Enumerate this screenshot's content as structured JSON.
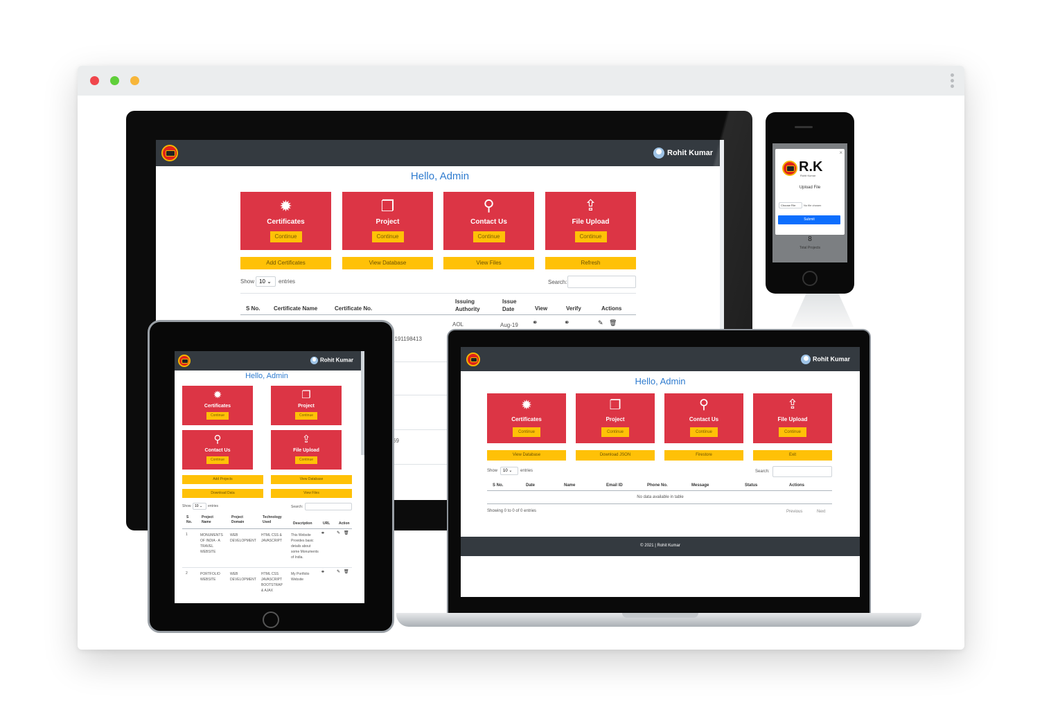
{
  "app": {
    "user_name": "Rohit Kumar",
    "greeting": "Hello, Admin",
    "continue_label": "Continue"
  },
  "monitor": {
    "tiles": [
      "Certificates",
      "Project",
      "Contact Us",
      "File Upload"
    ],
    "buttons": [
      "Add Certificates",
      "View Database",
      "View Files",
      "Refresh"
    ],
    "show_label": "Show",
    "entries_value": "10",
    "entries_label": "entries",
    "search_label": "Search:",
    "columns": [
      "S No.",
      "Certificate Name",
      "Certificate No.",
      "Issuing Authority",
      "Issue Date",
      "View",
      "Verify",
      "Actions"
    ],
    "row": {
      "authority": "AOL",
      "date": "Aug-19"
    },
    "partial_cert_no": "0191198413",
    "partial_digits": "69"
  },
  "phone": {
    "brand": "R.K",
    "brand_sub": "Rohit Kumar",
    "title": "Upload File",
    "choose_label": "Choose File",
    "no_file_label": "No file chosen",
    "submit_label": "Submit",
    "count": "8",
    "count_label": "Total Projects"
  },
  "tablet": {
    "tiles": [
      "Certificates",
      "Project",
      "Contact Us",
      "File Upload"
    ],
    "buttons": [
      "Add Projects",
      "View Database",
      "Download Data",
      "View Files"
    ],
    "show_label": "Show",
    "entries_value": "10",
    "entries_label": "entries",
    "search_label": "Search:",
    "columns": [
      "S No.",
      "Project Name",
      "Project Domain",
      "Technology Used",
      "Description",
      "URL",
      "Action"
    ],
    "rows": [
      {
        "no": "1",
        "name": "MONUMENTS OF INDIA - A TRAVEL WEBSITE",
        "domain": "WEB DEVELOPMENT",
        "tech": "HTML CSS & JAVASCRIPT",
        "desc": "This Website Provides basic details about some Monuments of India."
      },
      {
        "no": "2",
        "name": "PORTFOLIO WEBSITE",
        "domain": "WEB DEVELOPMENT",
        "tech": "HTML CSS JAVASCRIPT BOOTSTRAP & AJAX",
        "desc": "My Portfolio Website"
      }
    ]
  },
  "laptop": {
    "tiles": [
      "Certificates",
      "Project",
      "Contact Us",
      "File Upload"
    ],
    "buttons": [
      "View Database",
      "Download JSON",
      "Firestore",
      "Exit"
    ],
    "show_label": "Show",
    "entries_value": "10",
    "entries_label": "entries",
    "search_label": "Search:",
    "columns": [
      "S No.",
      "Date",
      "Name",
      "Email ID",
      "Phone No.",
      "Message",
      "Status",
      "Actions"
    ],
    "empty_message": "No data available in table",
    "showing": "Showing 0 to 0 of 0 entries",
    "previous_label": "Previous",
    "next_label": "Next",
    "footer": "© 2021 | Rohit Kumar"
  },
  "icons": [
    "certificate-icon",
    "file-icon",
    "search-icon",
    "upload-icon",
    "link-icon",
    "edit-icon",
    "trash-icon"
  ],
  "colors": {
    "tile_red": "#dc3545",
    "button_yellow": "#ffc107",
    "nav_dark": "#343a40",
    "greeting_blue": "#2e7bcf"
  }
}
